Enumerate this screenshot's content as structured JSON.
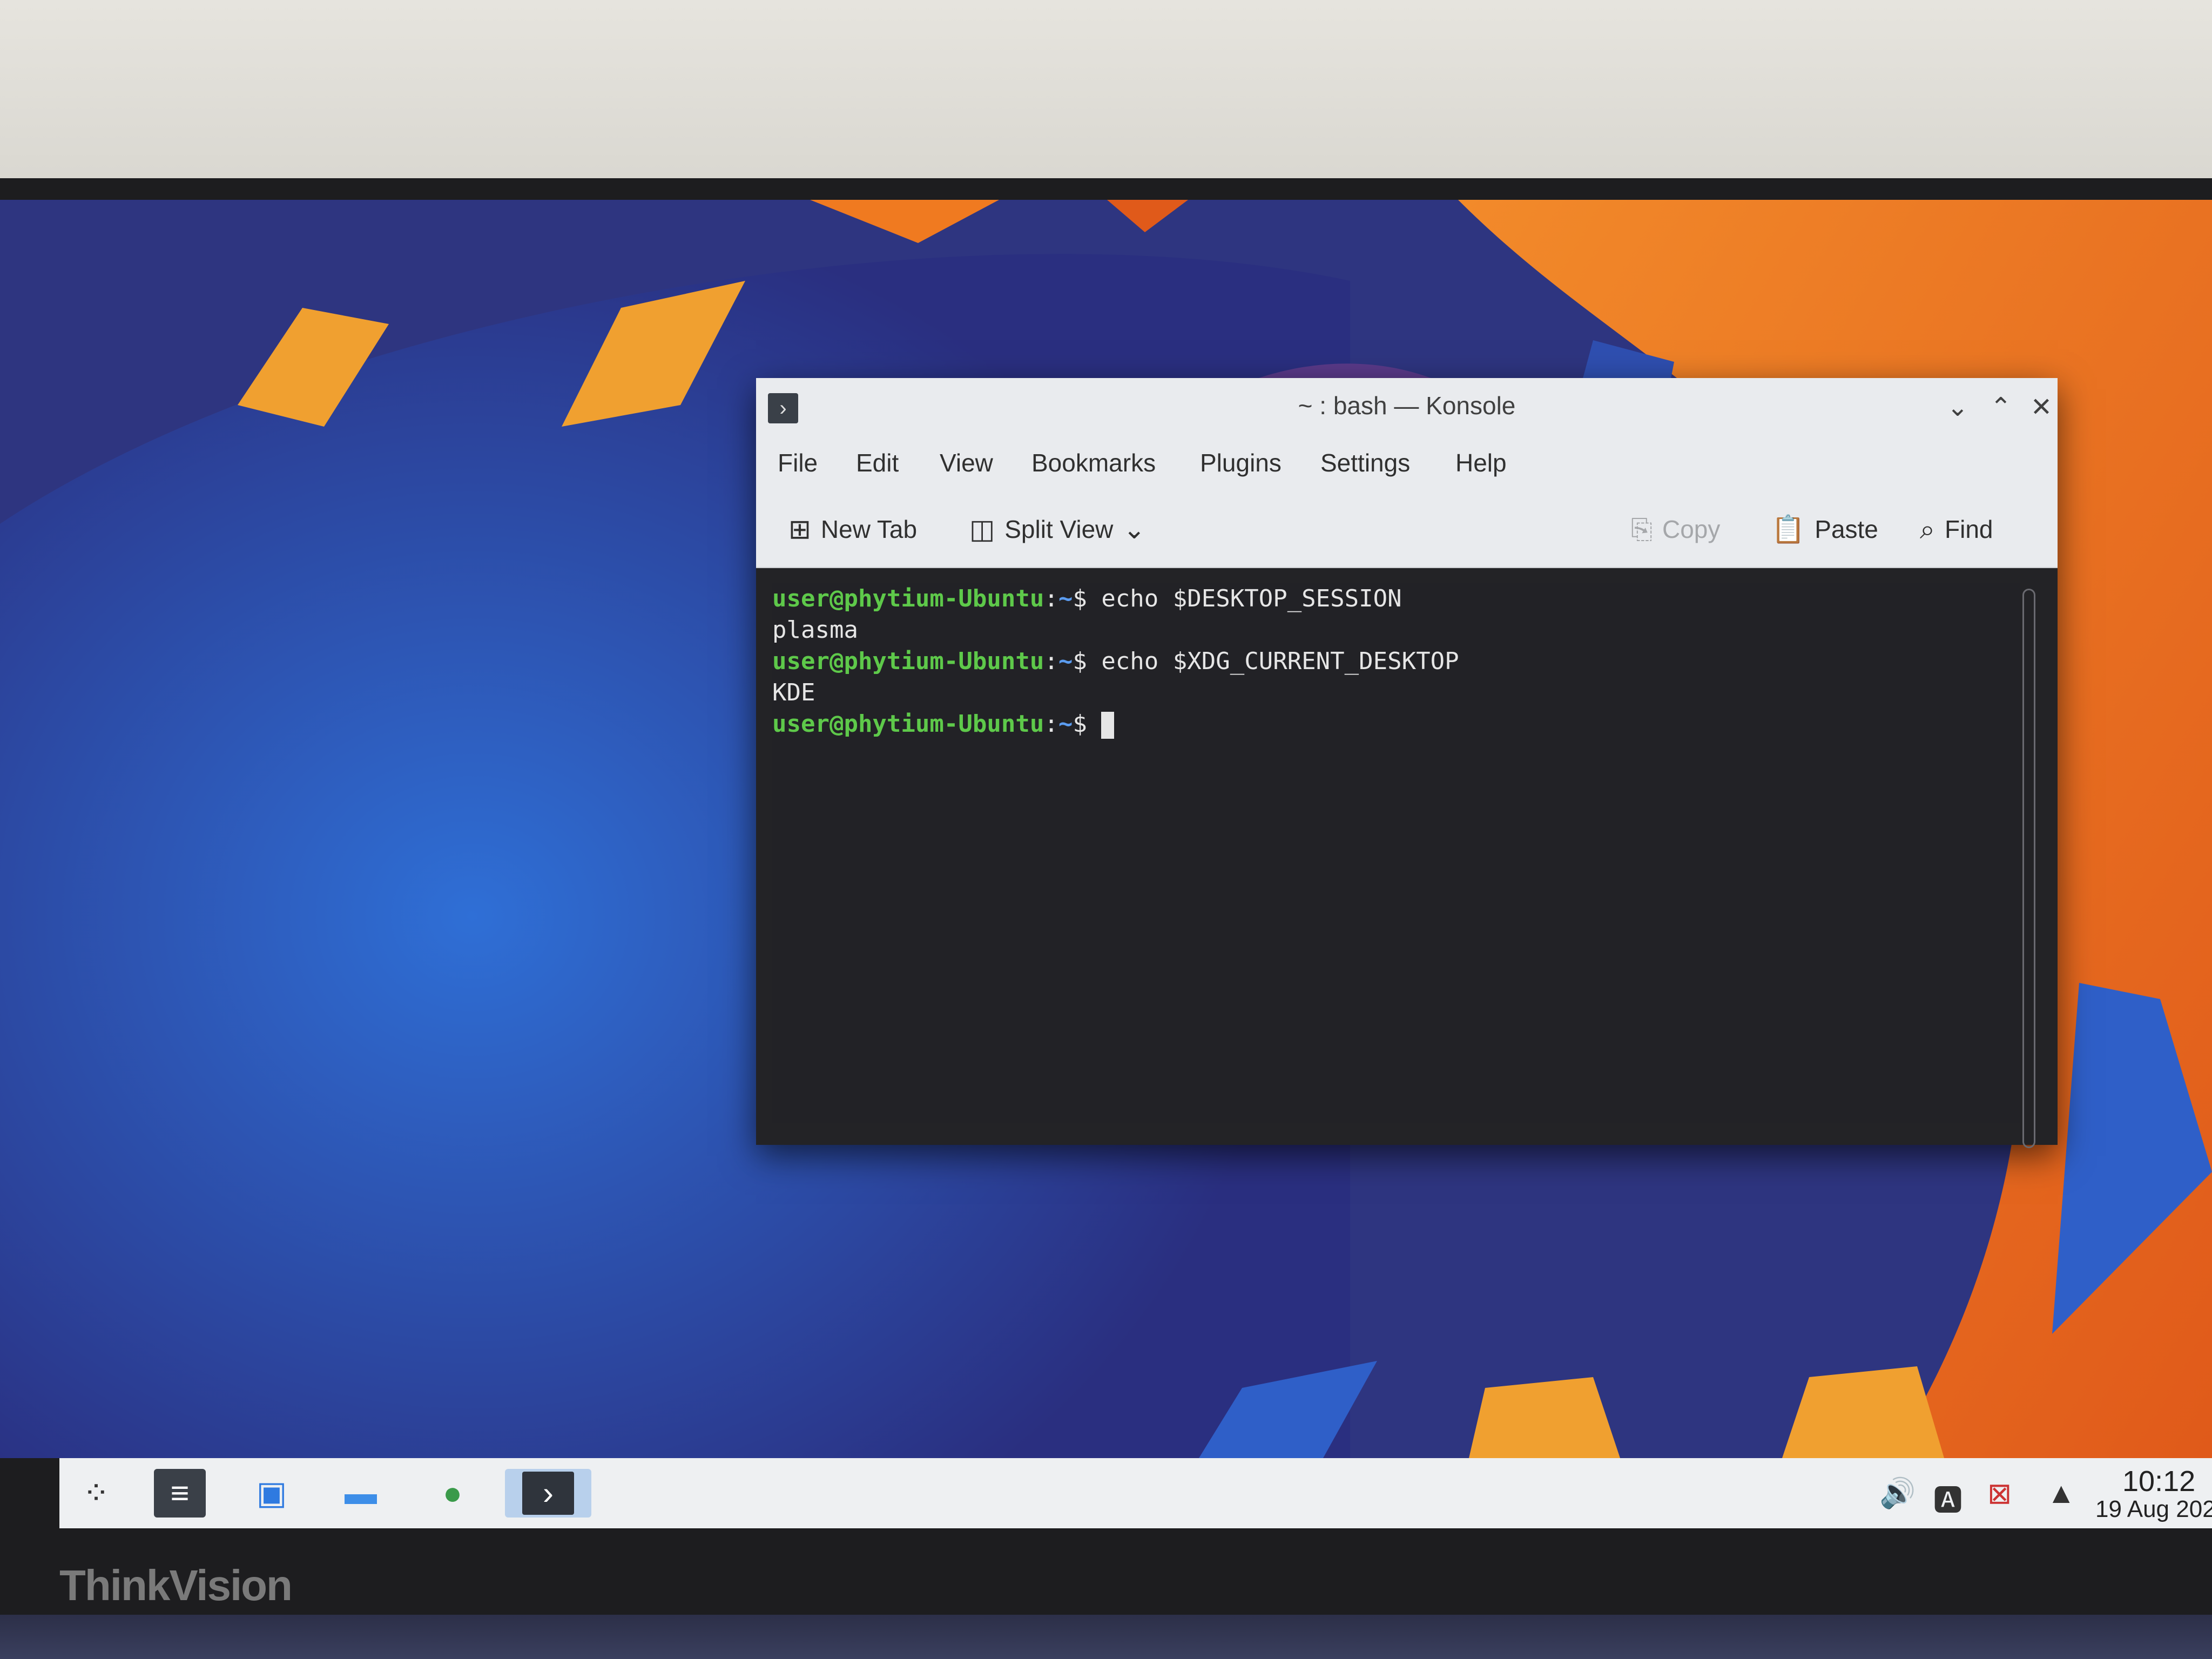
{
  "window": {
    "title": "~ : bash — Konsole",
    "app_icon": "terminal-icon",
    "controls": {
      "minimize": "⌄",
      "maximize": "⌃",
      "close": "✕"
    }
  },
  "menu": [
    "File",
    "Edit",
    "View",
    "Bookmarks",
    "Plugins",
    "Settings",
    "Help"
  ],
  "toolbar": {
    "new_tab": "New Tab",
    "split_view": "Split View",
    "copy": "Copy",
    "paste": "Paste",
    "find": "Find"
  },
  "terminal": {
    "lines": [
      {
        "user": "user@phytium-Ubuntu",
        "path": "~",
        "cmd": " echo $DESKTOP_SESSION"
      },
      {
        "output": "plasma"
      },
      {
        "user": "user@phytium-Ubuntu",
        "path": "~",
        "cmd": " echo $XDG_CURRENT_DESKTOP"
      },
      {
        "output": "KDE"
      },
      {
        "user": "user@phytium-Ubuntu",
        "path": "~",
        "cmd": " "
      }
    ]
  },
  "taskbar": {
    "icons": [
      "app-launcher-icon",
      "settings-icon",
      "discover-store-icon",
      "file-manager-icon",
      "browser-icon",
      "konsole-icon"
    ],
    "tray": [
      "volume-icon",
      "keyboard-layout-icon",
      "network-disconnected-icon",
      "tray-expand-icon"
    ],
    "clock_time": "10:12",
    "clock_date": "19 Aug 202"
  },
  "monitor": {
    "brand": "ThinkVision"
  }
}
